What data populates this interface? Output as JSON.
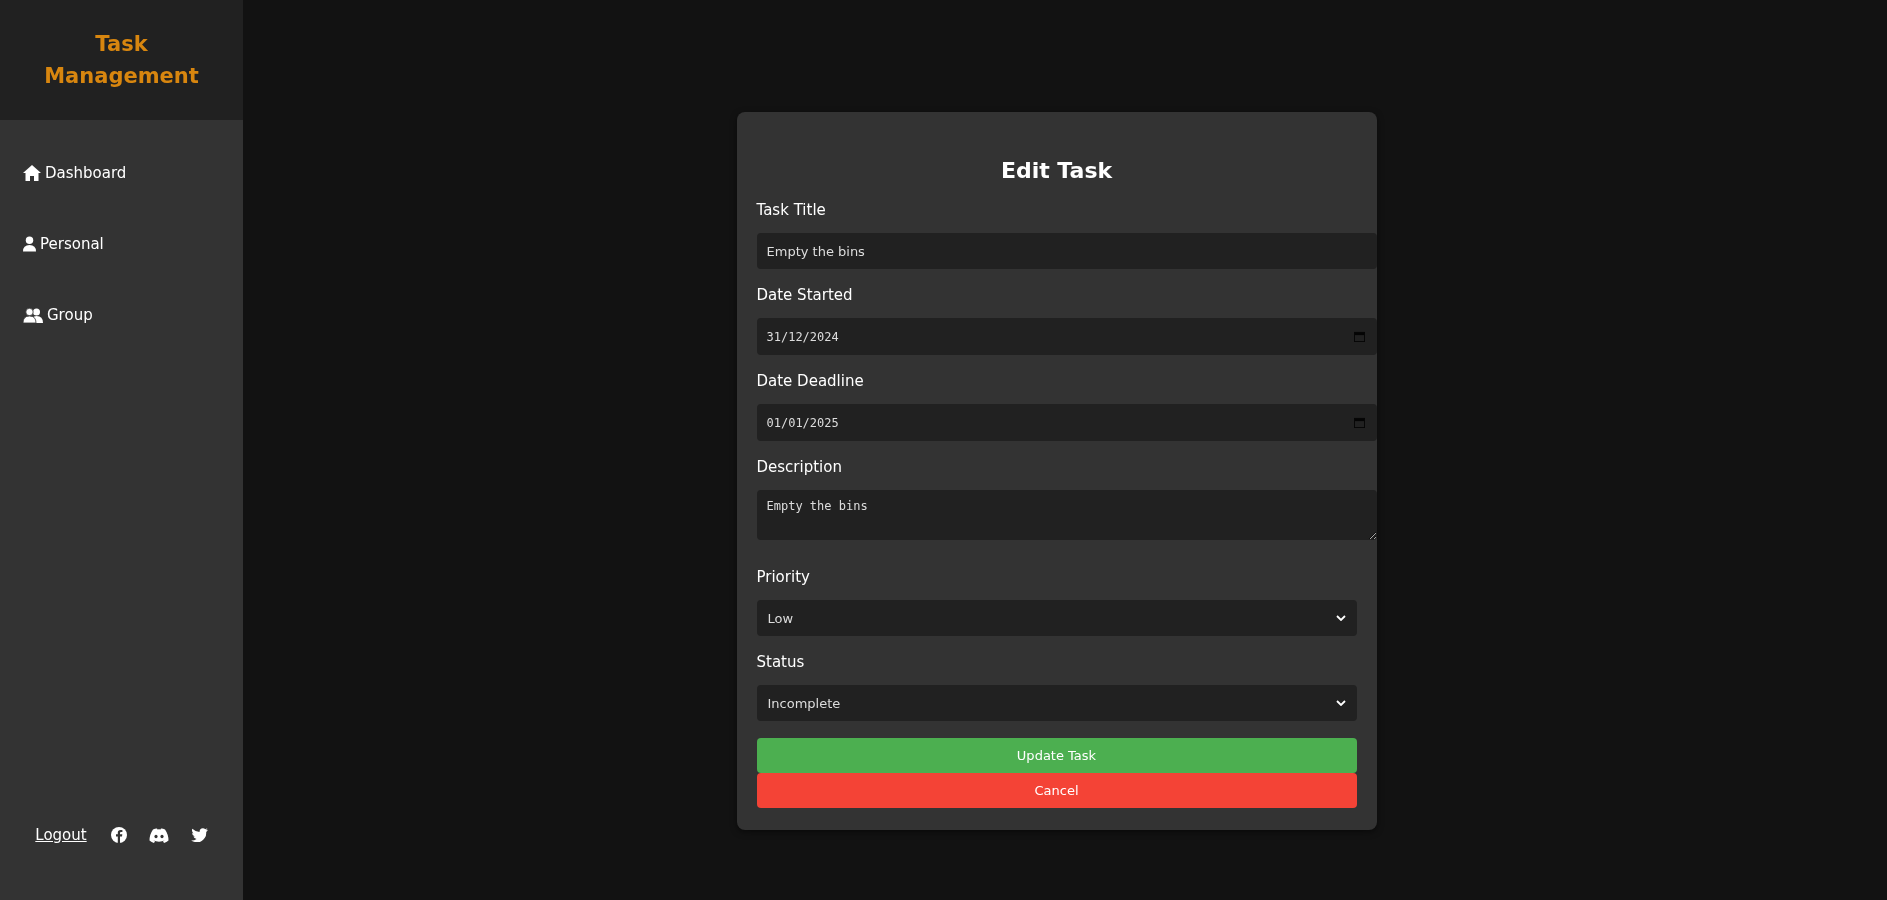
{
  "sidebar": {
    "logo": "Task Management",
    "items": [
      {
        "label": "Dashboard"
      },
      {
        "label": "Personal"
      },
      {
        "label": "Group"
      }
    ],
    "footer": {
      "logout": "Logout"
    }
  },
  "form": {
    "title": "Edit Task",
    "fields": [
      {
        "label": "Task Title",
        "kind": "text",
        "value": "Empty the bins"
      },
      {
        "label": "Date Started",
        "kind": "date",
        "value": "31/12/2024"
      },
      {
        "label": "Date Deadline",
        "kind": "date",
        "value": "01/01/2025"
      },
      {
        "label": "Description",
        "kind": "textarea",
        "value": "Empty the bins"
      },
      {
        "label": "Priority",
        "kind": "select",
        "value": "Low"
      },
      {
        "label": "Status",
        "kind": "select",
        "value": "Incomplete"
      }
    ],
    "buttons": [
      {
        "label": "Update Task",
        "kind": "primary"
      },
      {
        "label": "Cancel",
        "kind": "danger"
      }
    ]
  }
}
